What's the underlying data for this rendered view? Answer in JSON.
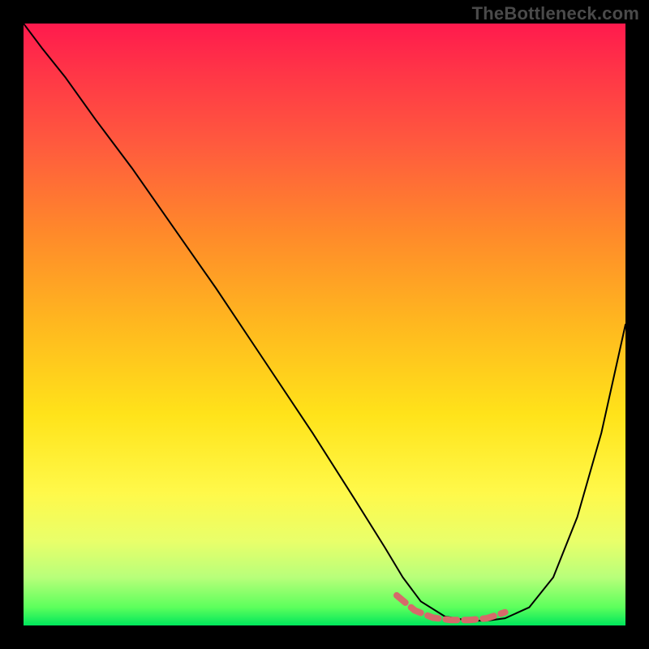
{
  "watermark": "TheBottleneck.com",
  "chart_data": {
    "type": "line",
    "title": "",
    "xlabel": "",
    "ylabel": "",
    "xlim": [
      0,
      100
    ],
    "ylim": [
      0,
      100
    ],
    "grid": false,
    "series": [
      {
        "name": "curve",
        "color": "#000000",
        "stroke_width": 2,
        "x": [
          0,
          3,
          7,
          12,
          18,
          25,
          32,
          40,
          48,
          55,
          60,
          63,
          66,
          70,
          74,
          77,
          80,
          84,
          88,
          92,
          96,
          100
        ],
        "y": [
          100,
          96,
          91,
          84,
          76,
          66,
          56,
          44,
          32,
          21,
          13,
          8,
          4,
          1.5,
          0.8,
          0.8,
          1.2,
          3,
          8,
          18,
          32,
          50
        ]
      },
      {
        "name": "trough-highlight",
        "color": "#d66a6a",
        "stroke_width": 8,
        "dash": [
          14,
          9
        ],
        "x": [
          62,
          65,
          68,
          71,
          74,
          77,
          80
        ],
        "y": [
          5,
          2.5,
          1.3,
          0.9,
          0.9,
          1.2,
          2.2
        ]
      }
    ],
    "background_gradient": {
      "top": "#ff1a4d",
      "bottom": "#00e65c"
    }
  }
}
